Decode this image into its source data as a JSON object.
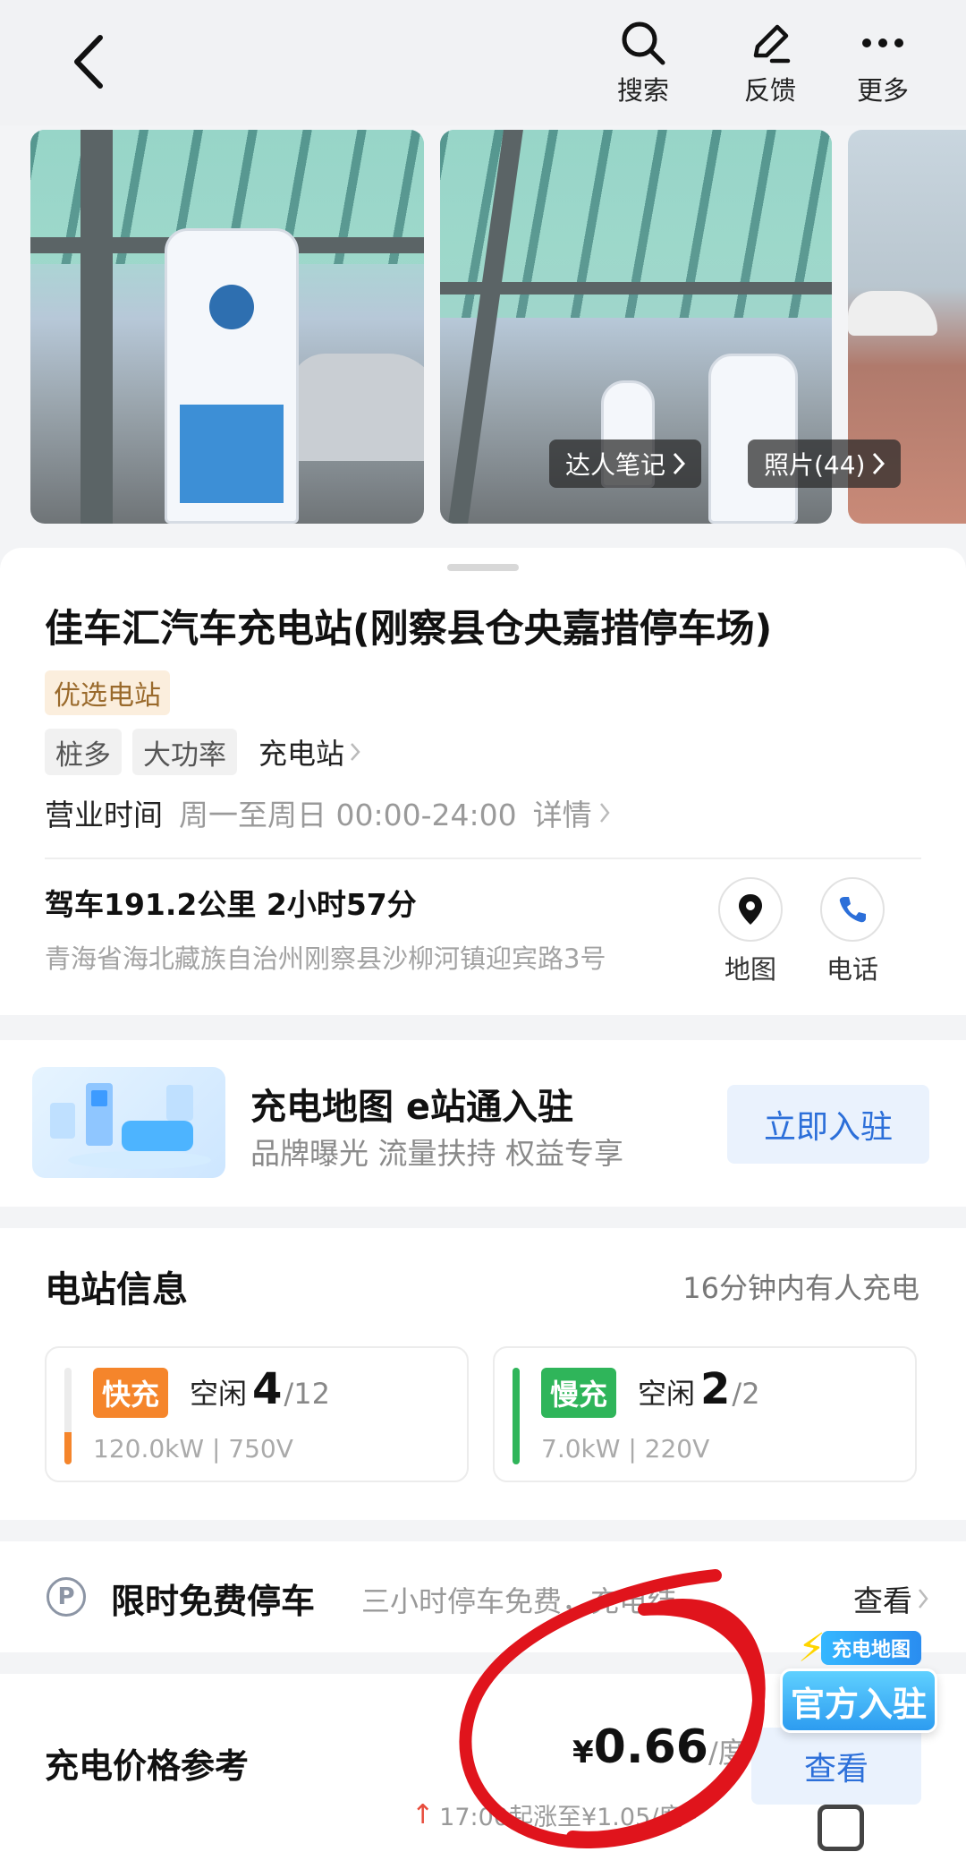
{
  "header": {
    "actions": [
      {
        "label": "搜索",
        "icon": "search-icon"
      },
      {
        "label": "反馈",
        "icon": "edit-icon"
      },
      {
        "label": "更多",
        "icon": "more-icon"
      }
    ]
  },
  "photos": {
    "notes_label": "达人笔记",
    "photos_label": "照片(44)"
  },
  "station": {
    "title": "佳车汇汽车充电站(刚察县仓央嘉措停车场)",
    "badge": "优选电站",
    "tags": [
      "桩多",
      "大功率"
    ],
    "category": "充电站",
    "hours_label": "营业时间",
    "hours_value": "周一至周日 00:00-24:00",
    "hours_detail": "详情",
    "drive": "驾车191.2公里 2小时57分",
    "address": "青海省海北藏族自治州刚察县沙柳河镇迎宾路3号",
    "map_label": "地图",
    "phone_label": "电话"
  },
  "promo": {
    "title": "充电地图  e站通入驻",
    "subtitle": "品牌曝光 流量扶持 权益专享",
    "button": "立即入驻"
  },
  "info": {
    "title": "电站信息",
    "note": "16分钟内有人充电",
    "fast": {
      "type": "快充",
      "idle_label": "空闲",
      "idle": "4",
      "total": "/12",
      "spec": "120.0kW | 750V",
      "color": "#f5852b",
      "level": 0.333
    },
    "slow": {
      "type": "慢充",
      "idle_label": "空闲",
      "idle": "2",
      "total": "/2",
      "spec": "7.0kW | 220V",
      "color": "#2fb55a",
      "level": 1.0
    }
  },
  "parking": {
    "icon_text": "P",
    "title": "限时免费停车",
    "desc": "三小时停车免费，充电结...",
    "view": "查看"
  },
  "price": {
    "title": "充电价格参考",
    "currency": "¥",
    "value": "0.66",
    "unit": "/度",
    "rise": "17:00起涨至¥1.05/度",
    "button": "查看"
  },
  "floating": {
    "top": "充电地图",
    "main": "官方入驻"
  },
  "colors": {
    "accent_blue": "#2c6fd9",
    "annotation_red": "#e0141c"
  }
}
